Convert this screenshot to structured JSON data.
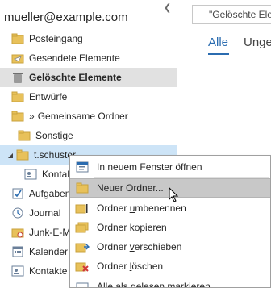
{
  "account": {
    "email": "mueller@example.com"
  },
  "folders": [
    {
      "label": "Posteingang"
    },
    {
      "label": "Gesendete Elemente"
    },
    {
      "label": "Gelöschte Elemente"
    },
    {
      "label": "Entwürfe"
    },
    {
      "label": "Gemeinsame Ordner"
    },
    {
      "label": "Sonstige"
    },
    {
      "label": "t.schuster"
    },
    {
      "label": "Kontakte"
    }
  ],
  "shared_prefix": "»",
  "bottom_nav": [
    {
      "label": "Aufgaben"
    },
    {
      "label": "Journal"
    },
    {
      "label": "Junk-E-Mail"
    },
    {
      "label": "Kalender"
    },
    {
      "label": "Kontakte"
    }
  ],
  "search": {
    "placeholder": "\"Gelöschte Elemente\" durchsuchen"
  },
  "tabs": {
    "all": "Alle",
    "unread": "Ungelesen"
  },
  "context_menu": {
    "open_new_window": "In neuem Fenster öffnen",
    "new_folder": "Neuer Ordner...",
    "rename_pre": "Ordner ",
    "rename_ul": "u",
    "rename_post": "mbenennen",
    "copy_pre": "Ordner ",
    "copy_ul": "k",
    "copy_post": "opieren",
    "move_pre": "Ordner ",
    "move_ul": "v",
    "move_post": "erschieben",
    "delete_pre": "Ordner ",
    "delete_ul": "l",
    "delete_post": "öschen",
    "partial_item": "Alle als gelesen markieren"
  },
  "colors": {
    "accent": "#2b6cb0",
    "selected": "#e1e1e1",
    "hover": "#cde4f7",
    "menu_highlight": "#c8c8c8",
    "folder": "#e8c15a"
  }
}
